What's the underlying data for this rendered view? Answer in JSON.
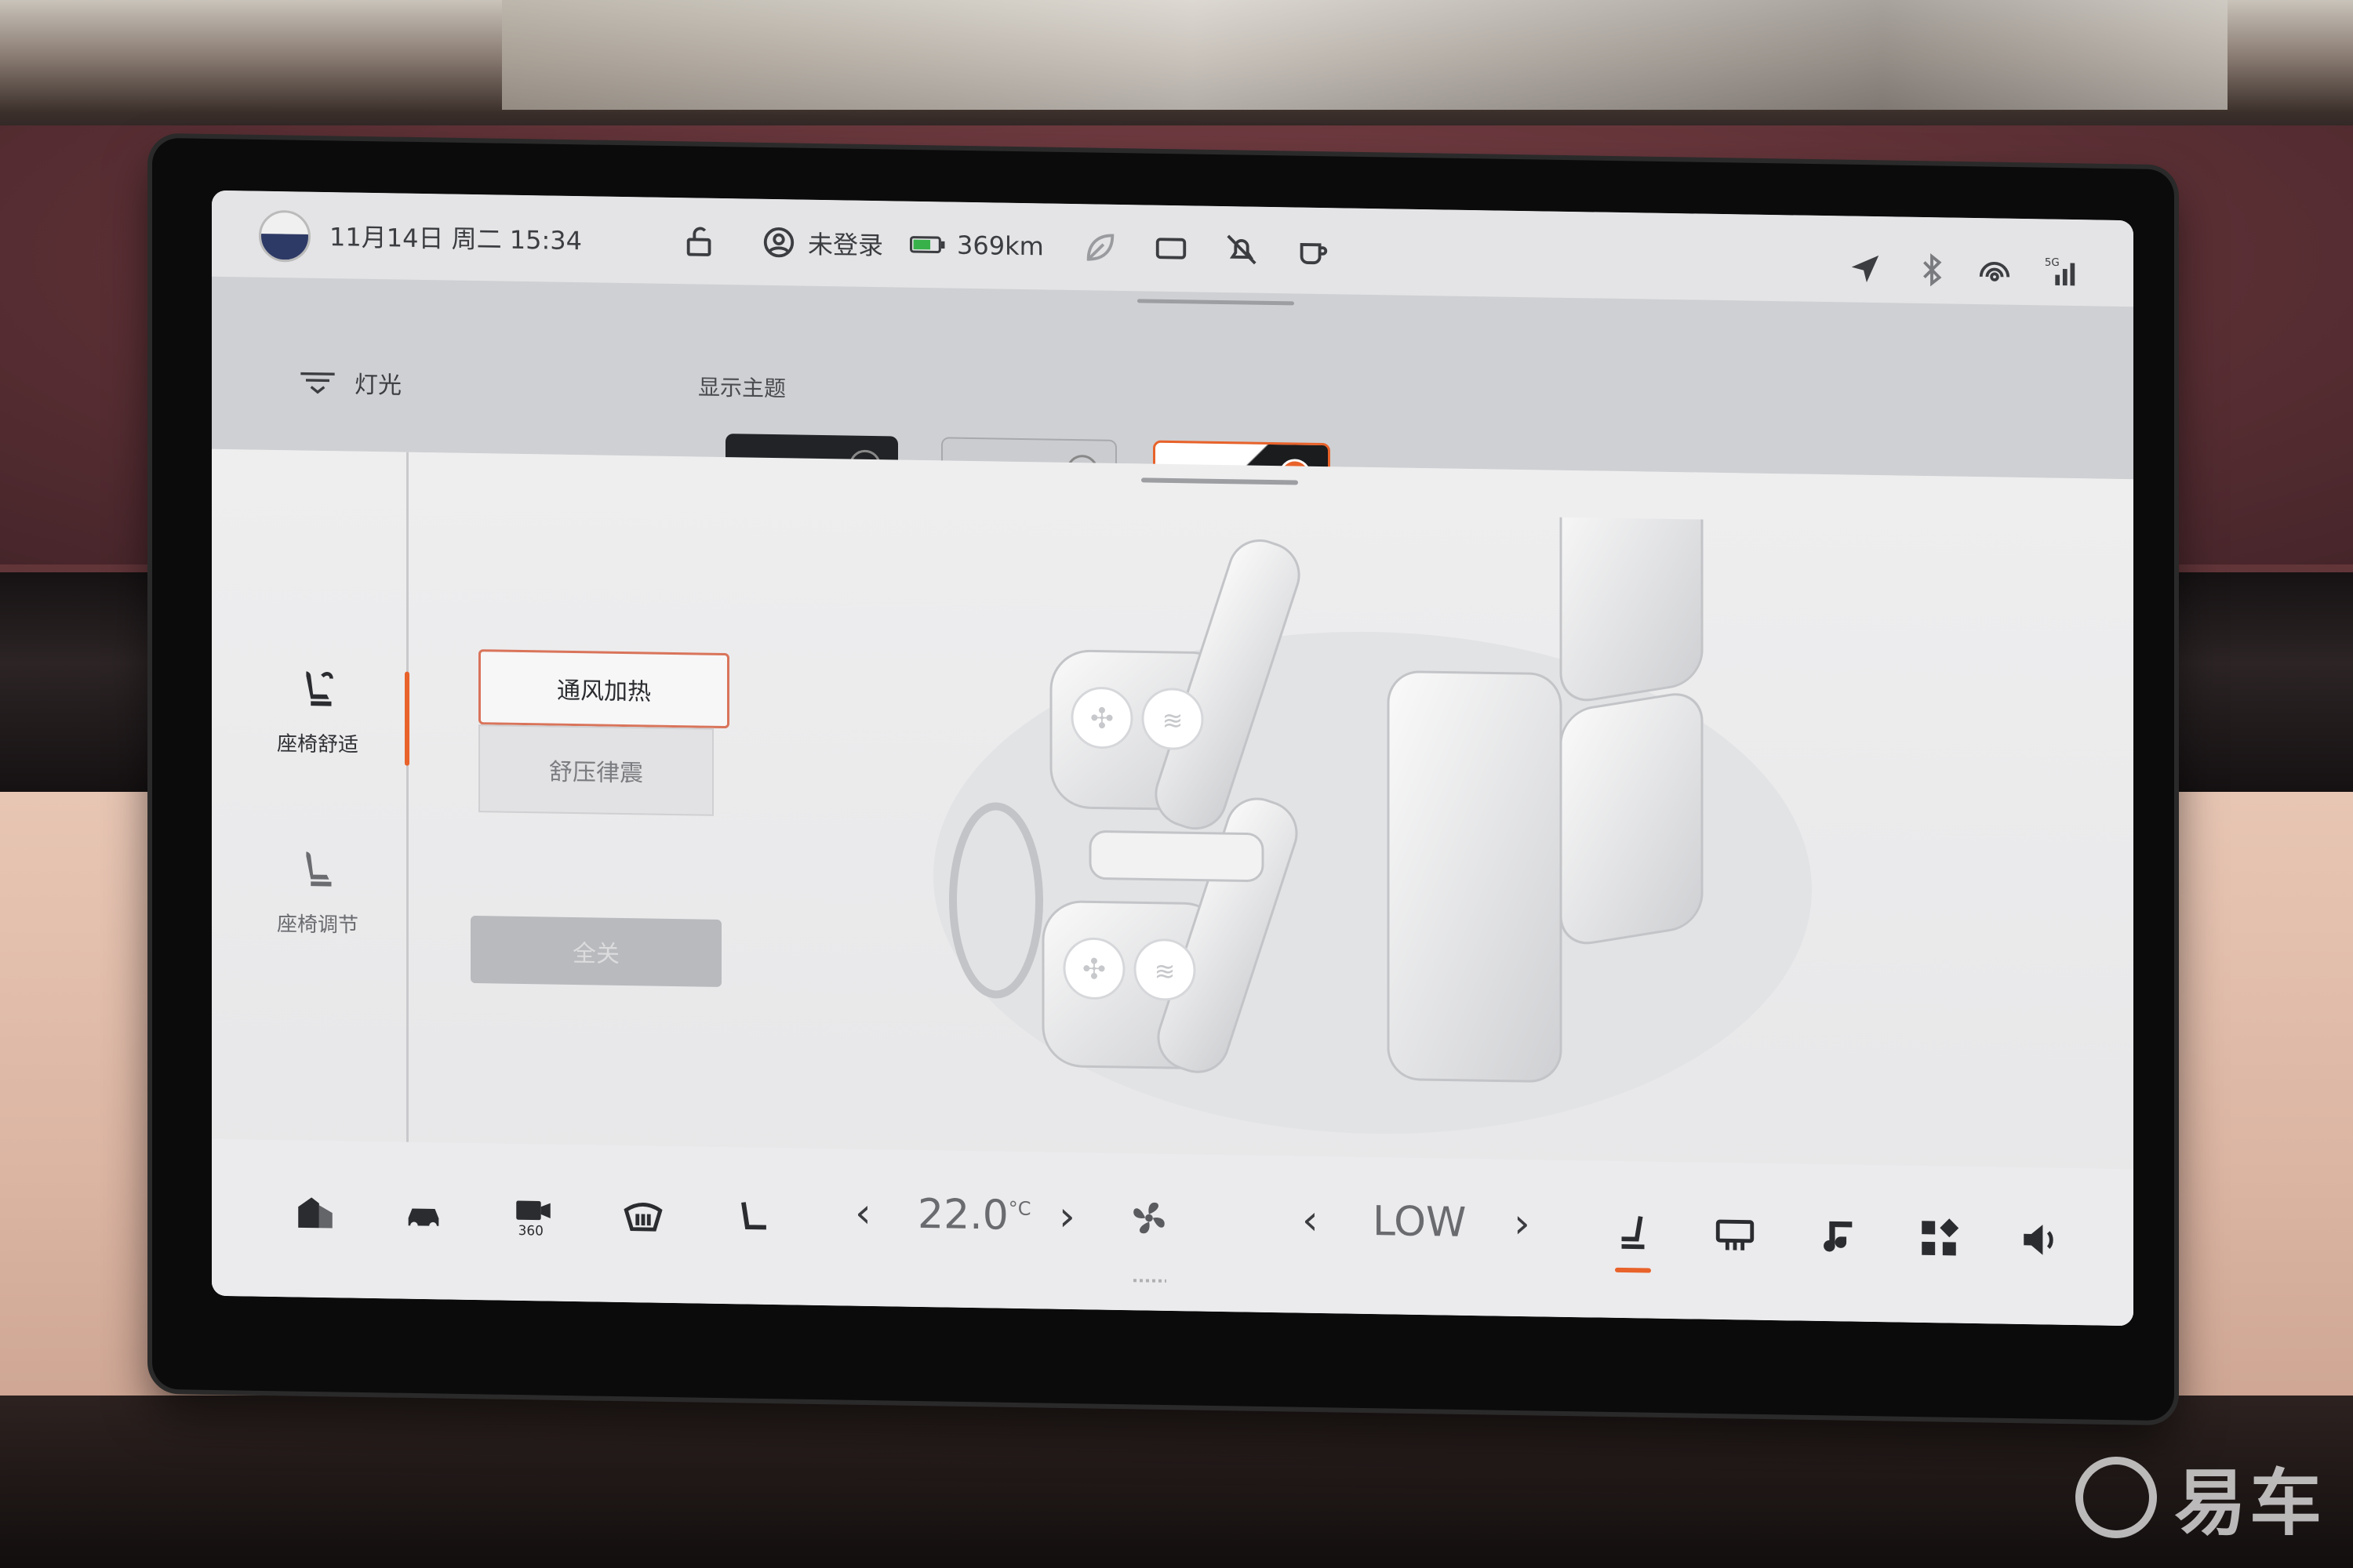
{
  "status_bar": {
    "datetime": "11月14日 周二 15:34",
    "user": "未登录",
    "range": "369km"
  },
  "lighting_drawer": {
    "light_label": "灯光",
    "theme_title": "显示主题"
  },
  "sidebar": {
    "items": [
      {
        "label": "座椅舒适",
        "icon": "seat-comfort-icon",
        "active": true
      },
      {
        "label": "座椅调节",
        "icon": "seat-adjust-icon",
        "active": false
      }
    ]
  },
  "seat_comfort": {
    "options": [
      "通风加热",
      "舒压律震"
    ],
    "selected": "通风加热",
    "all_off_label": "全关"
  },
  "dock": {
    "temperature_value": "22.0",
    "temperature_unit": "°C",
    "fan_level": "LOW"
  },
  "watermark": {
    "text": "易车"
  },
  "colors": {
    "accent": "#e8622a",
    "screen_bg": "#eeeeef",
    "text": "#303135"
  }
}
